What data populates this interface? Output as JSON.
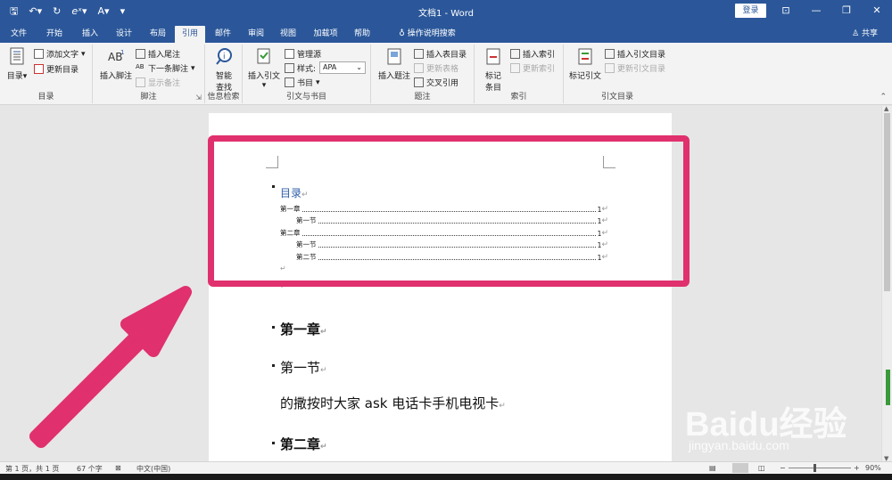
{
  "window": {
    "title": "文档1 - Word",
    "login_label": "登录",
    "share_label": "共享"
  },
  "tabs": [
    "文件",
    "开始",
    "插入",
    "设计",
    "布局",
    "引用",
    "邮件",
    "审阅",
    "视图",
    "加载项",
    "帮助"
  ],
  "tell_me": "操作说明搜索",
  "ribbon": {
    "toc_group": {
      "label": "目录",
      "toc_button": "目录",
      "add_text": "添加文字",
      "update_toc": "更新目录"
    },
    "footnote_group": {
      "label": "脚注",
      "insert_footnote": "插入脚注",
      "insert_endnote": "插入尾注",
      "next_footnote": "下一条脚注",
      "show_notes": "显示备注"
    },
    "research_group": {
      "label": "信息检索",
      "smart_lookup_line1": "智能",
      "smart_lookup_line2": "查找"
    },
    "citation_group": {
      "label": "引文与书目",
      "insert_citation": "插入引文",
      "manage_sources": "管理源",
      "style_label": "样式:",
      "style_value": "APA",
      "bibliography": "书目"
    },
    "caption_group": {
      "label": "题注",
      "insert_caption": "插入题注",
      "insert_table_of_figures": "插入表目录",
      "update_table": "更新表格",
      "cross_reference": "交叉引用"
    },
    "index_group": {
      "label": "索引",
      "mark_entry_line1": "标记",
      "mark_entry_line2": "条目",
      "insert_index": "插入索引",
      "update_index": "更新索引"
    },
    "authorities_group": {
      "label": "引文目录",
      "mark_citation": "标记引文",
      "insert_toa": "插入引文目录",
      "update_toa": "更新引文目录"
    }
  },
  "document": {
    "toc_title": "目录",
    "toc_entries": [
      {
        "label": "第一章",
        "page": "1"
      },
      {
        "label": "第一节",
        "page": "1"
      },
      {
        "label": "第二章",
        "page": "1"
      },
      {
        "label": "第一节",
        "page": "1"
      },
      {
        "label": "第二节",
        "page": "1"
      }
    ],
    "heading1": "第一章",
    "heading1_1": "第一节",
    "body": "的撒按时大家 ask 电话卡手机电视卡",
    "heading2": "第二章"
  },
  "statusbar": {
    "page_info": "第 1 页，共 1 页",
    "word_count": "67 个字",
    "language": "中文(中国)",
    "zoom": "90%"
  },
  "watermark": {
    "main": "Baidu经验",
    "sub": "jingyan.baidu.com"
  },
  "colors": {
    "accent": "#2b579a",
    "highlight": "#e0306e",
    "toc_title": "#2e5da8"
  }
}
